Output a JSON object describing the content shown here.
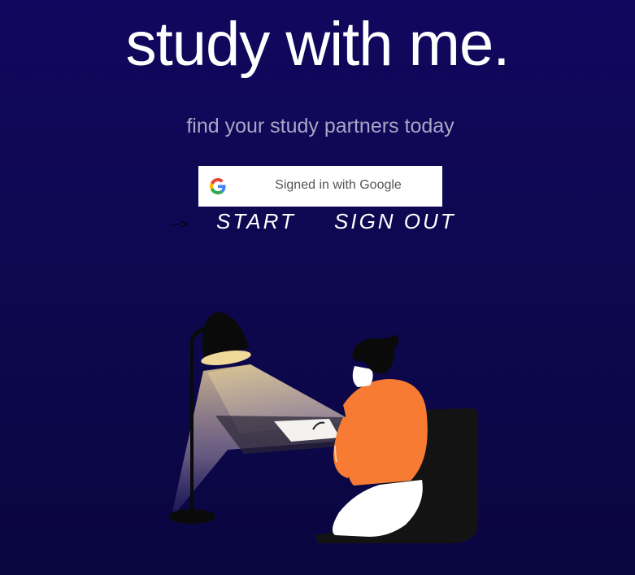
{
  "header": {
    "title": "study with me.",
    "subtitle": "find your study partners today"
  },
  "auth": {
    "google_button_label": "Signed in with Google",
    "icon": "google-g-icon"
  },
  "actions": {
    "arrow": "-->",
    "start_label": "START",
    "sign_out_label": "SIGN OUT"
  },
  "illustration": {
    "description_icon": "person-studying-under-lamp",
    "colors": {
      "background_top": "#12075e",
      "background_bottom": "#0a0640",
      "sweater": "#f77b32",
      "chair": "#131313",
      "lamp_light": "#f0d89a"
    }
  }
}
